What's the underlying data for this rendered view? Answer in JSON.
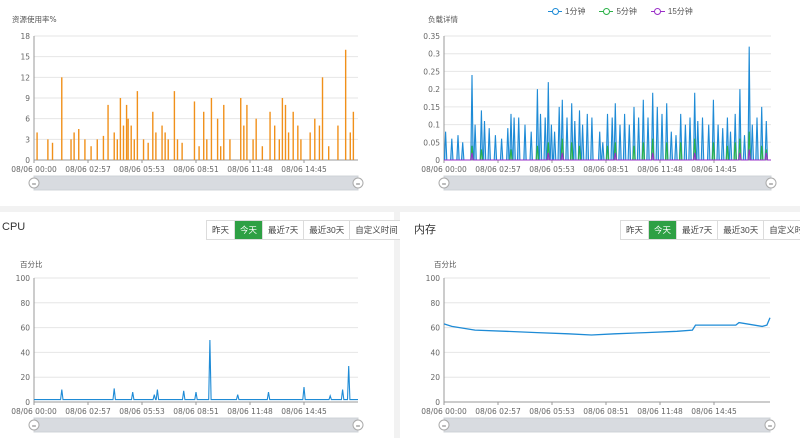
{
  "colors": {
    "orange": "#f0901a",
    "blue": "#1e8bd6",
    "green": "#2bb248",
    "purple": "#9a2fc8",
    "active_button": "#2ea044"
  },
  "resource_usage": {
    "ylabel": "资源使用率%"
  },
  "load_detail": {
    "ylabel": "负载详情"
  },
  "legend": [
    "1分钟",
    "5分钟",
    "15分钟"
  ],
  "cpu": {
    "title": "CPU",
    "ylabel": "百分比"
  },
  "memory": {
    "title": "内存",
    "ylabel": "百分比"
  },
  "range_buttons": [
    "昨天",
    "今天",
    "最近7天",
    "最近30天",
    "自定义时间"
  ],
  "active_range": "今天",
  "chart_data": [
    {
      "type": "bar",
      "title": "资源使用率%",
      "x_ticks": [
        "08/06 00:00",
        "08/06 02:57",
        "08/06 05:53",
        "08/06 08:51",
        "08/06 11:48",
        "08/06 14:45"
      ],
      "ylim": [
        0,
        18
      ],
      "y_ticks": [
        0,
        3,
        6,
        9,
        12,
        15,
        18
      ],
      "series": [
        {
          "color": "#f0901a",
          "spikes": [
            [
              0.02,
              4
            ],
            [
              0.09,
              3
            ],
            [
              0.12,
              2.5
            ],
            [
              0.18,
              12
            ],
            [
              0.24,
              3
            ],
            [
              0.26,
              4
            ],
            [
              0.29,
              4.5
            ],
            [
              0.33,
              3
            ],
            [
              0.37,
              2
            ],
            [
              0.41,
              3
            ],
            [
              0.45,
              3.5
            ],
            [
              0.48,
              8
            ],
            [
              0.52,
              4
            ],
            [
              0.54,
              3
            ],
            [
              0.56,
              9
            ],
            [
              0.58,
              5
            ],
            [
              0.6,
              8
            ],
            [
              0.61,
              6
            ],
            [
              0.63,
              5
            ],
            [
              0.65,
              3
            ],
            [
              0.67,
              10
            ],
            [
              0.71,
              3
            ],
            [
              0.74,
              2.5
            ],
            [
              0.77,
              7
            ],
            [
              0.79,
              4
            ],
            [
              0.83,
              5
            ],
            [
              0.85,
              4
            ],
            [
              0.87,
              3
            ],
            [
              0.91,
              10
            ],
            [
              0.93,
              3
            ],
            [
              0.96,
              2.5
            ],
            [
              1.04,
              8.5
            ],
            [
              1.07,
              2
            ],
            [
              1.1,
              7
            ],
            [
              1.12,
              3
            ],
            [
              1.15,
              9
            ],
            [
              1.19,
              6
            ],
            [
              1.21,
              2
            ],
            [
              1.23,
              8
            ],
            [
              1.27,
              3
            ],
            [
              1.34,
              9
            ],
            [
              1.36,
              5
            ],
            [
              1.38,
              8
            ],
            [
              1.42,
              3
            ],
            [
              1.44,
              6
            ],
            [
              1.48,
              2
            ],
            [
              1.53,
              7
            ],
            [
              1.56,
              5
            ],
            [
              1.59,
              3
            ],
            [
              1.61,
              9
            ],
            [
              1.63,
              8
            ],
            [
              1.65,
              4
            ],
            [
              1.68,
              7
            ],
            [
              1.71,
              5
            ],
            [
              1.73,
              3
            ],
            [
              1.79,
              4
            ],
            [
              1.82,
              6
            ],
            [
              1.85,
              5
            ],
            [
              1.87,
              12
            ],
            [
              1.91,
              2
            ],
            [
              1.97,
              5
            ],
            [
              2.02,
              16
            ],
            [
              2.05,
              4
            ],
            [
              2.07,
              7
            ]
          ]
        }
      ]
    },
    {
      "type": "area",
      "title": "负载详情",
      "x_ticks": [
        "08/06 00:00",
        "08/06 02:57",
        "08/06 05:53",
        "08/06 08:51",
        "08/06 11:48",
        "08/06 14:45"
      ],
      "ylim": [
        0,
        0.35
      ],
      "y_ticks": [
        0,
        0.05,
        0.1,
        0.15,
        0.2,
        0.25,
        0.3,
        0.35
      ],
      "series": [
        {
          "name": "1分钟",
          "color": "#1e8bd6",
          "spikes": [
            [
              0.01,
              0.08
            ],
            [
              0.05,
              0.06
            ],
            [
              0.09,
              0.07
            ],
            [
              0.12,
              0.05
            ],
            [
              0.18,
              0.24
            ],
            [
              0.2,
              0.1
            ],
            [
              0.24,
              0.14
            ],
            [
              0.26,
              0.11
            ],
            [
              0.29,
              0.09
            ],
            [
              0.33,
              0.07
            ],
            [
              0.37,
              0.06
            ],
            [
              0.41,
              0.09
            ],
            [
              0.43,
              0.13
            ],
            [
              0.45,
              0.12
            ],
            [
              0.48,
              0.12
            ],
            [
              0.52,
              0.1
            ],
            [
              0.56,
              0.08
            ],
            [
              0.6,
              0.2
            ],
            [
              0.62,
              0.13
            ],
            [
              0.65,
              0.12
            ],
            [
              0.67,
              0.22
            ],
            [
              0.69,
              0.1
            ],
            [
              0.71,
              0.08
            ],
            [
              0.74,
              0.15
            ],
            [
              0.76,
              0.17
            ],
            [
              0.79,
              0.12
            ],
            [
              0.82,
              0.16
            ],
            [
              0.84,
              0.11
            ],
            [
              0.87,
              0.14
            ],
            [
              0.89,
              0.1
            ],
            [
              0.92,
              0.13
            ],
            [
              0.95,
              0.12
            ],
            [
              1.0,
              0.08
            ],
            [
              1.02,
              0.05
            ],
            [
              1.05,
              0.13
            ],
            [
              1.08,
              0.12
            ],
            [
              1.1,
              0.16
            ],
            [
              1.13,
              0.1
            ],
            [
              1.16,
              0.13
            ],
            [
              1.19,
              0.1
            ],
            [
              1.22,
              0.15
            ],
            [
              1.25,
              0.12
            ],
            [
              1.28,
              0.17
            ],
            [
              1.31,
              0.12
            ],
            [
              1.34,
              0.19
            ],
            [
              1.37,
              0.15
            ],
            [
              1.4,
              0.13
            ],
            [
              1.43,
              0.16
            ],
            [
              1.46,
              0.08
            ],
            [
              1.49,
              0.07
            ],
            [
              1.52,
              0.13
            ],
            [
              1.55,
              0.1
            ],
            [
              1.58,
              0.12
            ],
            [
              1.61,
              0.19
            ],
            [
              1.63,
              0.11
            ],
            [
              1.66,
              0.12
            ],
            [
              1.7,
              0.1
            ],
            [
              1.73,
              0.17
            ],
            [
              1.76,
              0.1
            ],
            [
              1.79,
              0.09
            ],
            [
              1.82,
              0.12
            ],
            [
              1.84,
              0.08
            ],
            [
              1.87,
              0.13
            ],
            [
              1.9,
              0.2
            ],
            [
              1.93,
              0.07
            ],
            [
              1.96,
              0.32
            ],
            [
              1.98,
              0.1
            ],
            [
              2.01,
              0.12
            ],
            [
              2.04,
              0.15
            ],
            [
              2.07,
              0.11
            ]
          ]
        },
        {
          "name": "5分钟",
          "color": "#2bb248",
          "spikes": [
            [
              0.18,
              0.04
            ],
            [
              0.24,
              0.03
            ],
            [
              0.43,
              0.03
            ],
            [
              0.6,
              0.04
            ],
            [
              0.67,
              0.05
            ],
            [
              0.76,
              0.06
            ],
            [
              0.82,
              0.05
            ],
            [
              0.87,
              0.04
            ],
            [
              1.05,
              0.04
            ],
            [
              1.1,
              0.05
            ],
            [
              1.22,
              0.04
            ],
            [
              1.28,
              0.05
            ],
            [
              1.34,
              0.06
            ],
            [
              1.43,
              0.05
            ],
            [
              1.52,
              0.05
            ],
            [
              1.61,
              0.06
            ],
            [
              1.73,
              0.05
            ],
            [
              1.82,
              0.04
            ],
            [
              1.87,
              0.05
            ],
            [
              1.9,
              0.06
            ],
            [
              1.96,
              0.08
            ],
            [
              2.04,
              0.04
            ],
            [
              2.07,
              0.03
            ]
          ]
        },
        {
          "name": "15分钟",
          "color": "#9a2fc8",
          "spikes": [
            [
              0.18,
              0.02
            ],
            [
              0.67,
              0.02
            ],
            [
              0.76,
              0.02
            ],
            [
              1.1,
              0.02
            ],
            [
              1.34,
              0.02
            ],
            [
              1.61,
              0.02
            ],
            [
              1.9,
              0.02
            ],
            [
              1.96,
              0.03
            ],
            [
              2.07,
              0.02
            ]
          ]
        }
      ]
    },
    {
      "type": "line",
      "title": "CPU",
      "ylabel": "百分比",
      "x_ticks": [
        "08/06 00:00",
        "08/06 02:57",
        "08/06 05:53",
        "08/06 08:51",
        "08/06 11:48",
        "08/06 14:45"
      ],
      "ylim": [
        0,
        100
      ],
      "y_ticks": [
        0,
        20,
        40,
        60,
        80,
        100
      ],
      "series": [
        {
          "color": "#1e8bd6",
          "baseline": 2,
          "spikes": [
            [
              0.18,
              10
            ],
            [
              0.52,
              11
            ],
            [
              0.64,
              8
            ],
            [
              0.78,
              6
            ],
            [
              0.8,
              10
            ],
            [
              0.97,
              9
            ],
            [
              1.05,
              8
            ],
            [
              1.14,
              50
            ],
            [
              1.32,
              6
            ],
            [
              1.52,
              8
            ],
            [
              1.75,
              12
            ],
            [
              1.92,
              5
            ],
            [
              2.0,
              10
            ],
            [
              2.04,
              29
            ]
          ]
        }
      ]
    },
    {
      "type": "line",
      "title": "内存",
      "ylabel": "百分比",
      "x_ticks": [
        "08/06 00:00",
        "08/06 02:57",
        "08/06 05:53",
        "08/06 08:51",
        "08/06 11:48",
        "08/06 14:45"
      ],
      "ylim": [
        0,
        100
      ],
      "y_ticks": [
        0,
        20,
        40,
        60,
        80,
        100
      ],
      "series": [
        {
          "color": "#1e8bd6",
          "points": [
            [
              0,
              63
            ],
            [
              0.05,
              61
            ],
            [
              0.2,
              58
            ],
            [
              0.4,
              57
            ],
            [
              0.6,
              56
            ],
            [
              0.8,
              55
            ],
            [
              0.95,
              54
            ],
            [
              1.1,
              55
            ],
            [
              1.3,
              56
            ],
            [
              1.5,
              57
            ],
            [
              1.6,
              58
            ],
            [
              1.62,
              62
            ],
            [
              1.7,
              62
            ],
            [
              1.88,
              62
            ],
            [
              1.9,
              64
            ],
            [
              2.05,
              61
            ],
            [
              2.08,
              62
            ],
            [
              2.1,
              68
            ]
          ]
        }
      ]
    }
  ]
}
